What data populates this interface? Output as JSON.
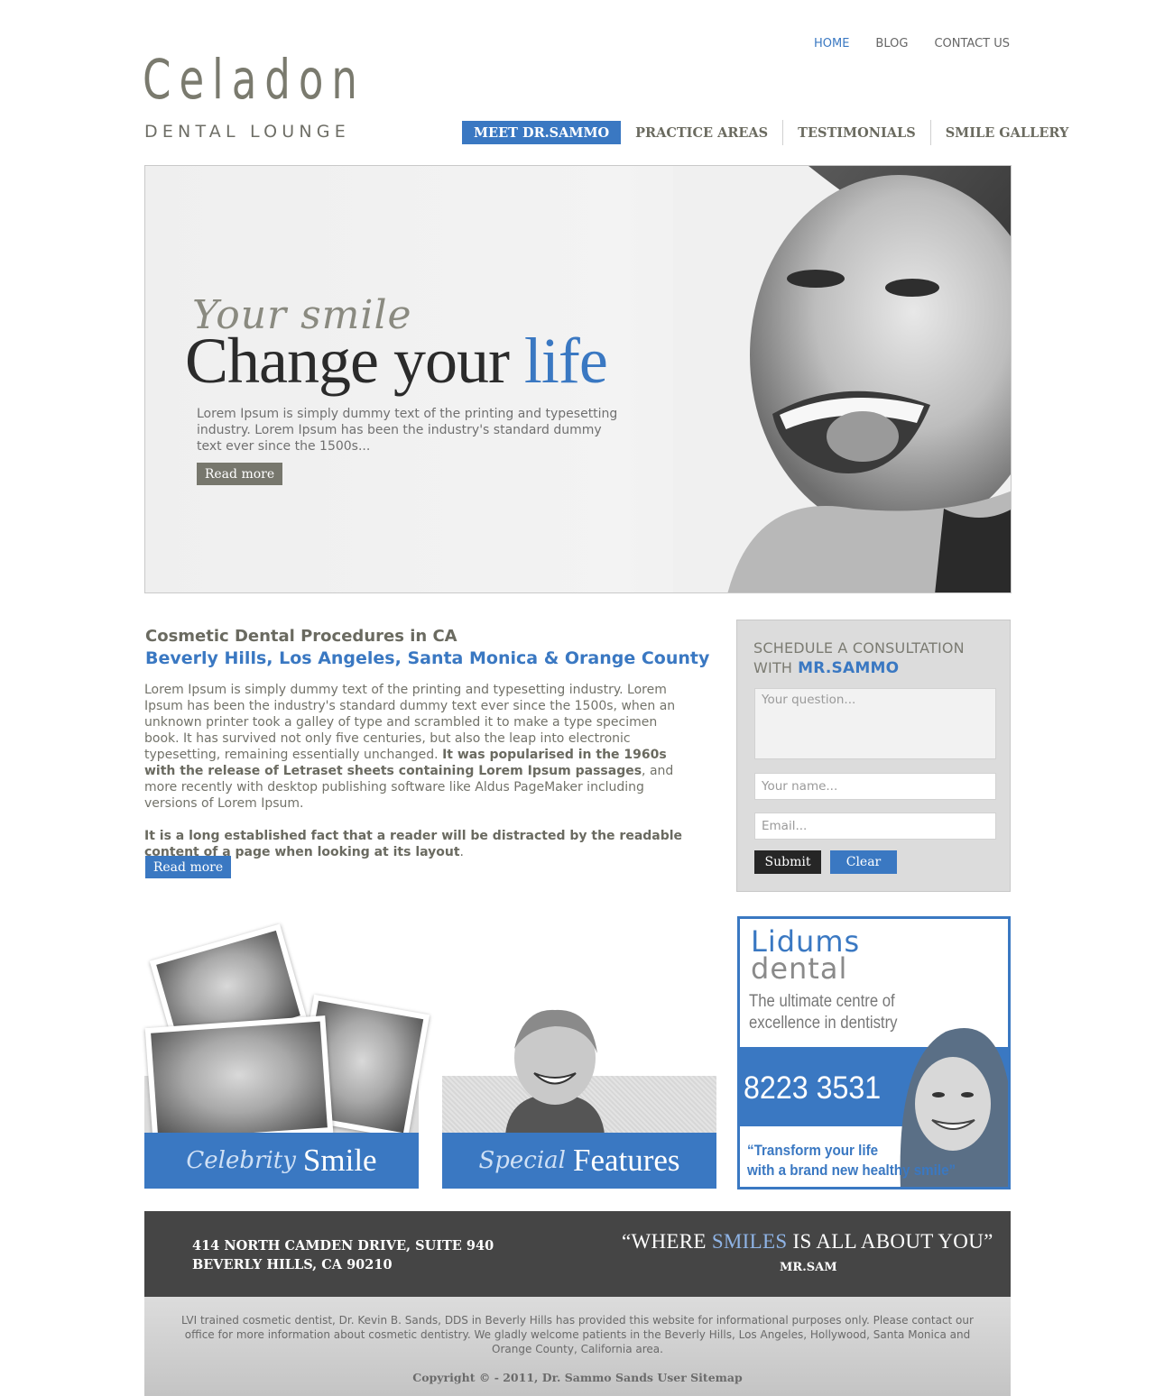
{
  "toplinks": {
    "home": "HOME",
    "blog": "BLOG",
    "contact": "CONTACT US"
  },
  "logo": {
    "name": "Celadon",
    "sub": "DENTAL LOUNGE"
  },
  "nav": {
    "items": [
      "MEET DR.SAMMO",
      "PRACTICE AREAS",
      "TESTIMONIALS",
      "SMILE GALLERY"
    ]
  },
  "hero": {
    "script": "Your smile",
    "headline_a": "Change your",
    "headline_b": "life",
    "text": "Lorem Ipsum is simply dummy text of the printing and typesetting industry. Lorem Ipsum has been the industry's standard dummy text ever since the 1500s...",
    "button": "Read more"
  },
  "content": {
    "title": "Cosmetic Dental Procedures in CA",
    "subtitle": "Beverly Hills, Los Angeles, Santa Monica & Orange County",
    "p1a": "Lorem Ipsum is simply dummy text of the printing and typesetting industry. Lorem Ipsum has been the industry's standard dummy text ever since the 1500s, when an unknown printer took a galley of type and scrambled it to make a type specimen book. It has survived not only five centuries, but also the leap into electronic typesetting, remaining essentially unchanged.",
    "p1b": "It was popularised in the 1960s with the release of Letraset sheets containing Lorem Ipsum passages",
    "p1c": ", and more recently with desktop publishing software like Aldus PageMaker including versions of Lorem Ipsum.",
    "p2a": "It is a long established fact that a reader will be distracted by the readable content of a page when looking at its layout",
    "p2b": ".",
    "button": "Read more"
  },
  "schedule": {
    "heading1": "SCHEDULE A CONSULTATION",
    "heading2": "WITH",
    "heading_name": "MR.SAMMO",
    "question_placeholder": "Your question...",
    "name_placeholder": "Your name...",
    "email_placeholder": "Email...",
    "submit": "Submit",
    "clear": "Clear"
  },
  "tiles": [
    {
      "script": "Celebrity",
      "word": "Smile"
    },
    {
      "script": "Special",
      "word": "Features"
    }
  ],
  "ad": {
    "brand1": "Lidums",
    "brand2": "dental",
    "tagline1": "The ultimate centre of",
    "tagline2": "excellence in dentistry",
    "phone": "8223 3531",
    "quote1": "“Transform your life",
    "quote2": "with a brand new healthy smile”"
  },
  "footer": {
    "addr1": "414 NORTH CAMDEN DRIVE, SUITE 940",
    "addr2": "BEVERLY HILLS, CA 90210",
    "quote_a": "“WHERE",
    "quote_b": "SMILES",
    "quote_c": "IS ALL ABOUT YOU”",
    "quote_by": "MR.SAM",
    "disclaimer": "LVI trained cosmetic dentist, Dr. Kevin B. Sands, DDS in Beverly Hills has provided this website for informational purposes only. Please contact our office for more information about cosmetic dentistry. We gladly welcome patients in the Beverly Hills, Los Angeles, Hollywood, Santa Monica and Orange County, California area.",
    "copyright": "Copyright © - 2011, Dr. Sammo Sands User Sitemap"
  },
  "colors": {
    "accent": "#3a78c2",
    "dark": "#454545",
    "olive": "#77776d"
  }
}
